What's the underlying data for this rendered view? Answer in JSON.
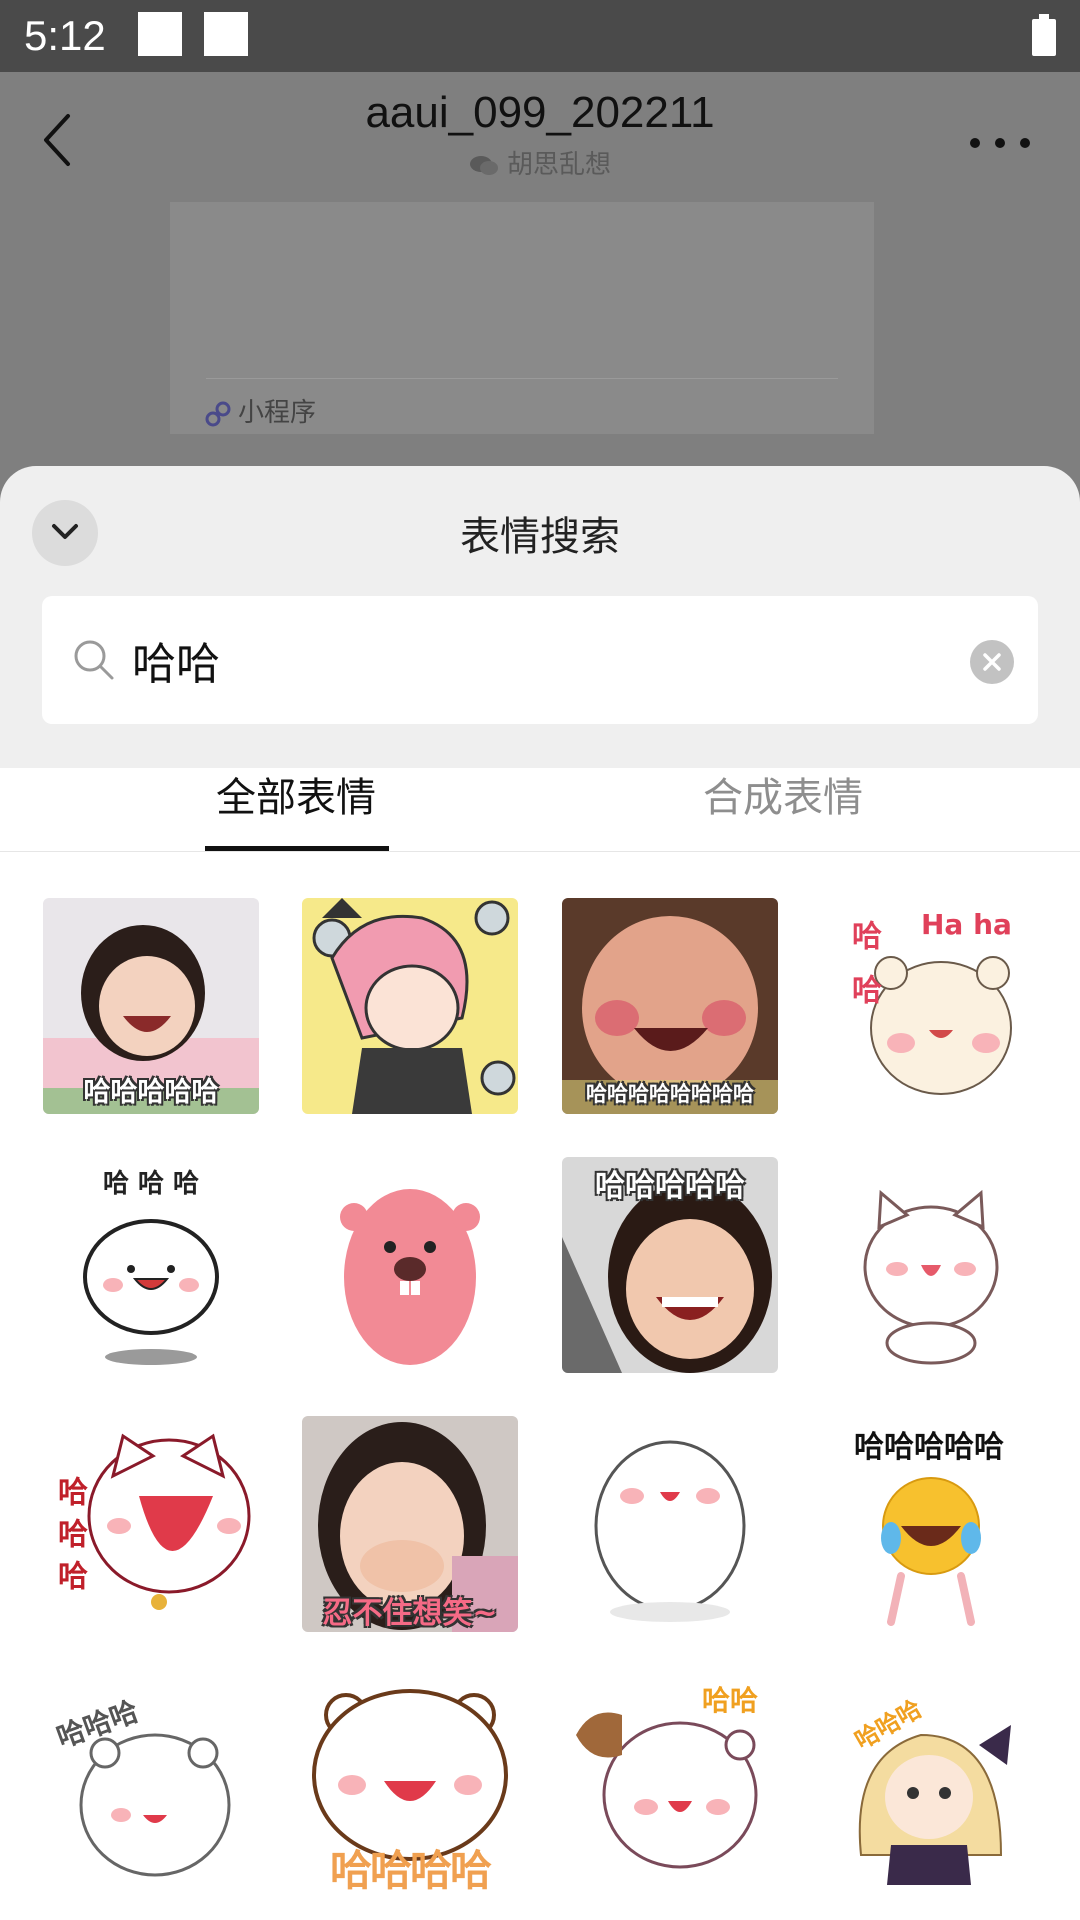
{
  "status_bar": {
    "time": "5:12"
  },
  "chat": {
    "title": "aaui_099_202211",
    "subtitle": "胡思乱想",
    "mini_program_label": "小程序"
  },
  "sheet": {
    "title": "表情搜索",
    "search": {
      "query": "哈哈"
    },
    "tabs": [
      {
        "label": "全部表情",
        "active": true
      },
      {
        "label": "合成表情",
        "active": false
      }
    ]
  },
  "stickers": [
    {
      "id": "girl-laugh",
      "caption": "哈哈哈哈哈"
    },
    {
      "id": "anime-pink-girl",
      "caption": ""
    },
    {
      "id": "chubby-boy",
      "caption": "哈哈哈哈哈哈哈哈"
    },
    {
      "id": "bear-haha",
      "caption": "Ha ha",
      "side_text": "哈哈"
    },
    {
      "id": "white-blob-haha",
      "caption": "哈 哈 哈"
    },
    {
      "id": "pink-beaver",
      "caption": ""
    },
    {
      "id": "kid-laugh",
      "caption": "哈哈哈哈哈"
    },
    {
      "id": "white-cat-laugh",
      "caption": ""
    },
    {
      "id": "cat-big-mouth",
      "caption": "哈哈哈"
    },
    {
      "id": "girl-cover-mouth",
      "caption": "忍不住想笑~"
    },
    {
      "id": "white-cat-chubby",
      "caption": ""
    },
    {
      "id": "emoji-dance",
      "caption": "哈哈哈哈哈"
    },
    {
      "id": "bear-giggle",
      "caption": "哈哈哈"
    },
    {
      "id": "bear-face",
      "caption": "哈哈哈哈"
    },
    {
      "id": "bear-fan",
      "caption": "哈哈"
    },
    {
      "id": "anime-blonde",
      "caption": "哈哈哈"
    }
  ],
  "colors": {
    "accent_tab": "#111111",
    "sheet_bg": "#efefef",
    "scrim": "#7f7f7f"
  }
}
